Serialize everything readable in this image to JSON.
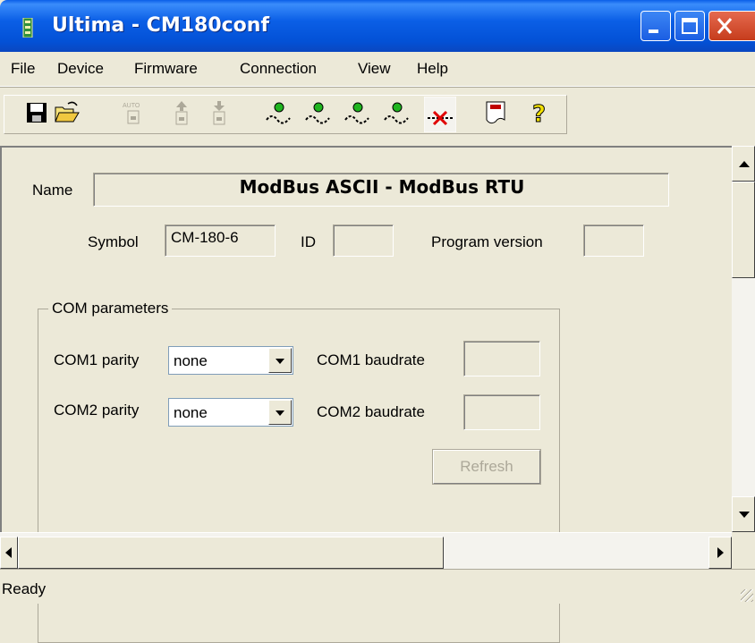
{
  "window": {
    "title": "Ultima - CM180conf",
    "controls": [
      "minimize-icon",
      "maximize-icon",
      "close-icon"
    ]
  },
  "menu": [
    "File",
    "Device",
    "Firmware",
    "Connection",
    "View",
    "Help"
  ],
  "toolbar": {
    "buttons": [
      {
        "icon": "save-icon",
        "enabled": true
      },
      {
        "icon": "open-folder-icon",
        "enabled": true
      },
      {
        "icon": "auto-upload-icon",
        "enabled": false
      },
      {
        "icon": "upload-icon",
        "enabled": false
      },
      {
        "icon": "download-icon",
        "enabled": false
      },
      {
        "icon": "connect-1-icon",
        "enabled": true
      },
      {
        "icon": "connect-2-icon",
        "enabled": true
      },
      {
        "icon": "connect-3-icon",
        "enabled": true
      },
      {
        "icon": "connect-4-icon",
        "enabled": true
      },
      {
        "icon": "disconnect-icon",
        "enabled": true
      },
      {
        "icon": "doc-icon",
        "enabled": true
      },
      {
        "icon": "help-icon",
        "enabled": true
      }
    ],
    "auto_label": "AUTO"
  },
  "device": {
    "name_label": "Name",
    "name_value": "ModBus ASCII - ModBus RTU",
    "symbol_label": "Symbol",
    "symbol_value": "CM-180-6",
    "id_label": "ID",
    "id_value": "",
    "program_version_label": "Program version",
    "program_version_value": ""
  },
  "com": {
    "group_title": "COM parameters",
    "com1_parity_label": "COM1 parity",
    "com1_parity_value": "none",
    "com1_baudrate_label": "COM1 baudrate",
    "com1_baudrate_value": "",
    "com2_parity_label": "COM2 parity",
    "com2_parity_value": "none",
    "com2_baudrate_label": "COM2 baudrate",
    "com2_baudrate_value": "",
    "refresh_label": "Refresh"
  },
  "status": {
    "text": "Ready"
  },
  "colors": {
    "titlebar": "#0a5ee8",
    "window_bg": "#ece9d8",
    "close_button": "#d04a2c",
    "connect_green": "#1fb41f"
  }
}
